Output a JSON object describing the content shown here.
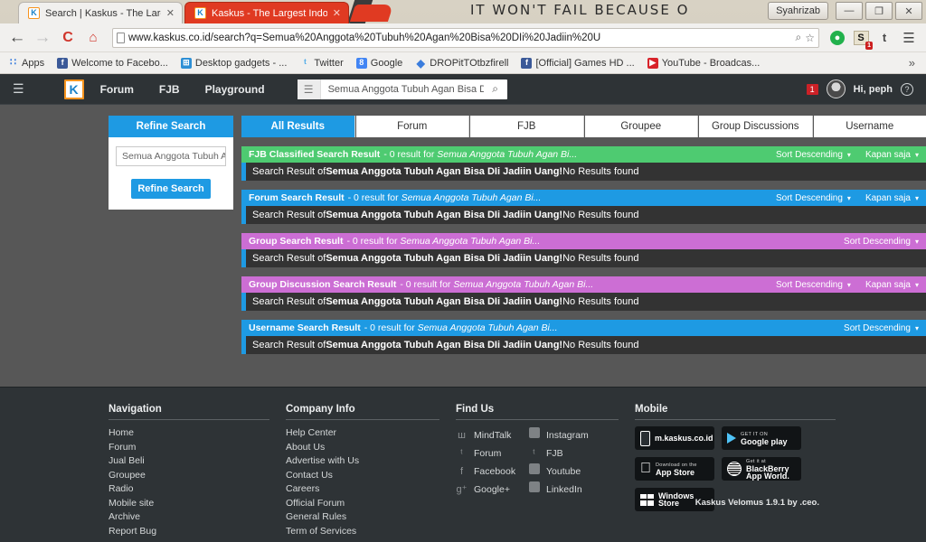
{
  "desktop": {
    "wallpaper_text": "IT  WON'T  FAIL  BECAUSE  O"
  },
  "window": {
    "user_button": "Syahrizab",
    "minimize": "—",
    "maximize": "❐",
    "close": "✕"
  },
  "browser": {
    "tabs": [
      {
        "favicon": "K",
        "title": "Search | Kaskus - The Larg",
        "close": "✕",
        "active": false
      },
      {
        "favicon": "K",
        "title": "Kaskus - The Largest Indo",
        "close": "✕",
        "active": true
      }
    ],
    "toolbar": {
      "back": "←",
      "forward": "→",
      "reload": "C",
      "home": "⌂",
      "url": "www.kaskus.co.id/search?q=Semua%20Anggota%20Tubuh%20Agan%20Bisa%20DIi%20Jadiin%20U",
      "zoom_icon": "⌕",
      "bookmark_star": "☆",
      "ext_green": "●",
      "ext_s": "S",
      "ext_s_badge": "1",
      "ext_t": "t",
      "menu": "☰"
    },
    "bookmarks": [
      {
        "icon": "apps-icon",
        "glyph": "∷",
        "label": "Apps"
      },
      {
        "icon": "facebook-icon",
        "glyph": "f",
        "label": "Welcome to Facebo..."
      },
      {
        "icon": "windows-icon",
        "glyph": "⊞",
        "label": "Desktop gadgets - ..."
      },
      {
        "icon": "twitter-icon",
        "glyph": "ᵗ",
        "label": "Twitter"
      },
      {
        "icon": "google-icon",
        "glyph": "8",
        "label": "Google"
      },
      {
        "icon": "dropbox-icon",
        "glyph": "◆",
        "label": "DROPitTOtbzfirell"
      },
      {
        "icon": "facebook-icon",
        "glyph": "f",
        "label": "[Official] Games HD ..."
      },
      {
        "icon": "youtube-icon",
        "glyph": "▶",
        "label": "YouTube - Broadcas..."
      }
    ],
    "bookmarks_overflow": "»"
  },
  "site_header": {
    "burger": "☰",
    "logo": "K",
    "nav": [
      "Forum",
      "FJB",
      "Playground"
    ],
    "search": {
      "category_icon": "☰",
      "value": "Semua Anggota Tubuh Agan Bisa DIi",
      "search_icon": "⌕"
    },
    "notification_count": "1",
    "greeting": "Hi, peph",
    "help": "?"
  },
  "sidebar": {
    "refine_header": "Refine Search",
    "input_value": "Semua Anggota Tubuh A",
    "refine_button": "Refine Search"
  },
  "tabs": [
    {
      "label": "All Results",
      "active": true
    },
    {
      "label": "Forum",
      "active": false
    },
    {
      "label": "FJB",
      "active": false
    },
    {
      "label": "Groupee",
      "active": false
    },
    {
      "label": "Group Discussions",
      "active": false
    },
    {
      "label": "Username",
      "active": false
    }
  ],
  "result_blocks": [
    {
      "title": "FJB Classified Search Result",
      "sub_prefix": " - 0 result for ",
      "sub_query": "Semua Anggota Tubuh Agan Bi...",
      "header_color": "#4ecb71",
      "sort_label": "Sort Descending",
      "time_label": "Kapan saja",
      "has_time": true,
      "body_prefix": "Search Result of ",
      "body_query": "Semua Anggota Tubuh Agan Bisa DIi Jadiin Uang!",
      "body_suffix": " No Results found"
    },
    {
      "title": "Forum Search Result",
      "sub_prefix": " - 0 result for ",
      "sub_query": "Semua Anggota Tubuh Agan Bi...",
      "header_color": "#1e9ae3",
      "sort_label": "Sort Descending",
      "time_label": "Kapan saja",
      "has_time": true,
      "body_prefix": "Search Result of ",
      "body_query": "Semua Anggota Tubuh Agan Bisa DIi Jadiin Uang!",
      "body_suffix": " No Results found"
    },
    {
      "title": "Group Search Result",
      "sub_prefix": " - 0 result for ",
      "sub_query": "Semua Anggota Tubuh Agan Bi...",
      "header_color": "#cc6ed4",
      "sort_label": "Sort Descending",
      "time_label": "",
      "has_time": false,
      "body_prefix": "Search Result of ",
      "body_query": "Semua Anggota Tubuh Agan Bisa DIi Jadiin Uang!",
      "body_suffix": " No Results found"
    },
    {
      "title": "Group Discussion Search Result",
      "sub_prefix": " - 0 result for ",
      "sub_query": "Semua Anggota Tubuh Agan Bi...",
      "header_color": "#cc6ed4",
      "sort_label": "Sort Descending",
      "time_label": "Kapan saja",
      "has_time": true,
      "body_prefix": "Search Result of ",
      "body_query": "Semua Anggota Tubuh Agan Bisa DIi Jadiin Uang!",
      "body_suffix": " No Results found"
    },
    {
      "title": "Username Search Result",
      "sub_prefix": " - 0 result for ",
      "sub_query": "Semua Anggota Tubuh Agan Bi...",
      "header_color": "#1e9ae3",
      "sort_label": "Sort Descending",
      "time_label": "",
      "has_time": false,
      "body_prefix": "Search Result of ",
      "body_query": "Semua Anggota Tubuh Agan Bisa DIi Jadiin Uang!",
      "body_suffix": " No Results found"
    }
  ],
  "footer": {
    "navigation": {
      "title": "Navigation",
      "links": [
        "Home",
        "Forum",
        "Jual Beli",
        "Groupee",
        "Radio",
        "Mobile site",
        "Archive",
        "Report Bug"
      ]
    },
    "company": {
      "title": "Company Info",
      "links": [
        "Help Center",
        "About Us",
        "Advertise with Us",
        "Contact Us",
        "Careers",
        "Official Forum",
        "General Rules",
        "Term of Services"
      ]
    },
    "find_us": {
      "title": "Find Us",
      "left": [
        {
          "icon": "mindtalk-icon",
          "glyph": "ш",
          "label": "MindTalk"
        },
        {
          "icon": "twitter-icon",
          "glyph": "ᵗ",
          "label": "Forum"
        },
        {
          "icon": "facebook-icon",
          "glyph": "f",
          "label": "Facebook"
        },
        {
          "icon": "googleplus-icon",
          "glyph": "g⁺",
          "label": "Google+"
        }
      ],
      "right": [
        {
          "icon": "instagram-icon",
          "glyph": "▣",
          "label": "Instagram"
        },
        {
          "icon": "twitter-icon",
          "glyph": "ᵗ",
          "label": "FJB"
        },
        {
          "icon": "youtube-icon",
          "glyph": "▶",
          "label": "Youtube"
        },
        {
          "icon": "linkedin-icon",
          "glyph": "in",
          "label": "LinkedIn"
        }
      ]
    },
    "mobile": {
      "title": "Mobile",
      "badges": [
        {
          "icon": "phone-icon",
          "small": "",
          "large": "m.kaskus.co.id"
        },
        {
          "icon": "googleplay-icon",
          "small": "GET IT ON",
          "large": "Google play"
        },
        {
          "icon": "apple-icon",
          "small": "Download on the",
          "large": "App Store"
        },
        {
          "icon": "blackberry-icon",
          "small": "Get it at",
          "large": "BlackBerry App World."
        },
        {
          "icon": "windowsstore-icon",
          "small": "",
          "large": "Windows Store"
        }
      ]
    },
    "version": "Kaskus Velomus 1.9.1 by .ceo."
  }
}
